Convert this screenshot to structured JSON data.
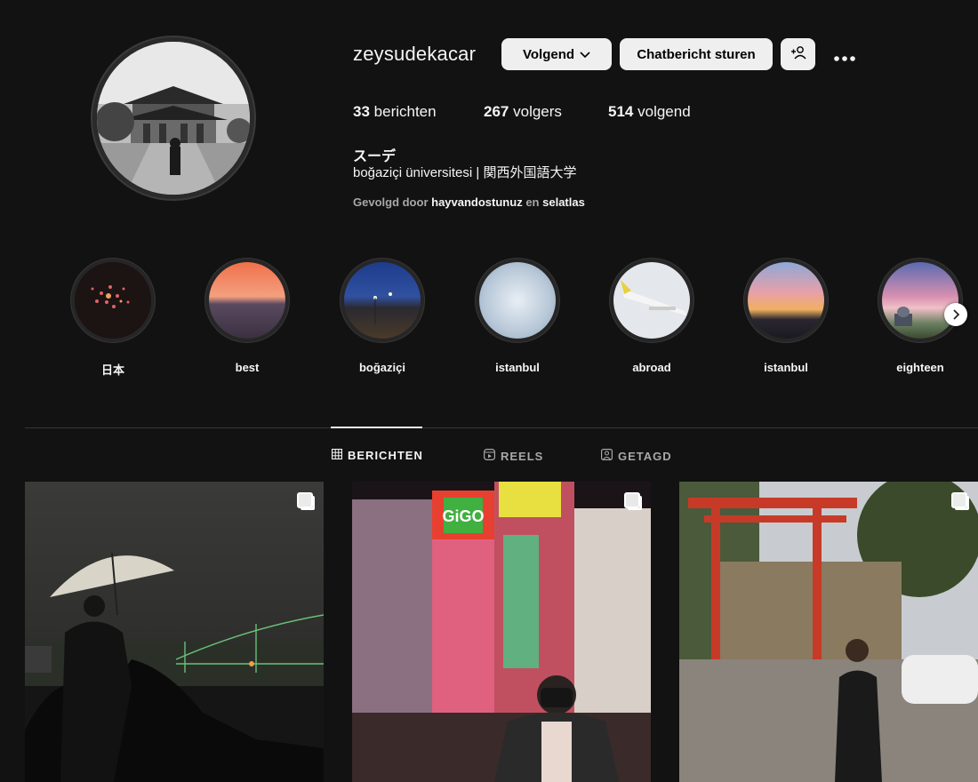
{
  "profile": {
    "username": "zeysudekacar",
    "follow_button": "Volgend",
    "message_button": "Chatbericht sturen",
    "add_friend_icon": "add-person-icon",
    "more_icon": "more-options-icon",
    "posts_count": "33",
    "posts_label": "berichten",
    "followers_count": "267",
    "followers_label": "volgers",
    "following_count": "514",
    "following_label": "volgend",
    "full_name": "スーデ",
    "bio": "boğaziçi üniversitesi | 関西外国語大学",
    "followed_by_prefix": "Gevolgd door",
    "followed_by_user1": "hayvandostunuz",
    "followed_by_joiner": "en",
    "followed_by_user2": "selatlas"
  },
  "highlights": [
    {
      "label": "日本"
    },
    {
      "label": "best"
    },
    {
      "label": "boğaziçi"
    },
    {
      "label": "istanbul"
    },
    {
      "label": "abroad"
    },
    {
      "label": "istanbul"
    },
    {
      "label": "eighteen"
    }
  ],
  "tabs": [
    {
      "label": "BERICHTEN",
      "icon": "grid-icon",
      "active": true
    },
    {
      "label": "REELS",
      "icon": "reels-icon",
      "active": false
    },
    {
      "label": "GETAGD",
      "icon": "tagged-icon",
      "active": false
    }
  ],
  "posts": [
    {
      "type": "carousel",
      "icon": "multiple-images-icon"
    },
    {
      "type": "carousel",
      "icon": "multiple-images-icon",
      "sign_text": "GiGO"
    },
    {
      "type": "carousel",
      "icon": "multiple-images-icon"
    }
  ],
  "colors": {
    "background": "#121212",
    "button_bg": "#efefef",
    "muted_text": "#a8a8a8",
    "divider": "#363636"
  }
}
